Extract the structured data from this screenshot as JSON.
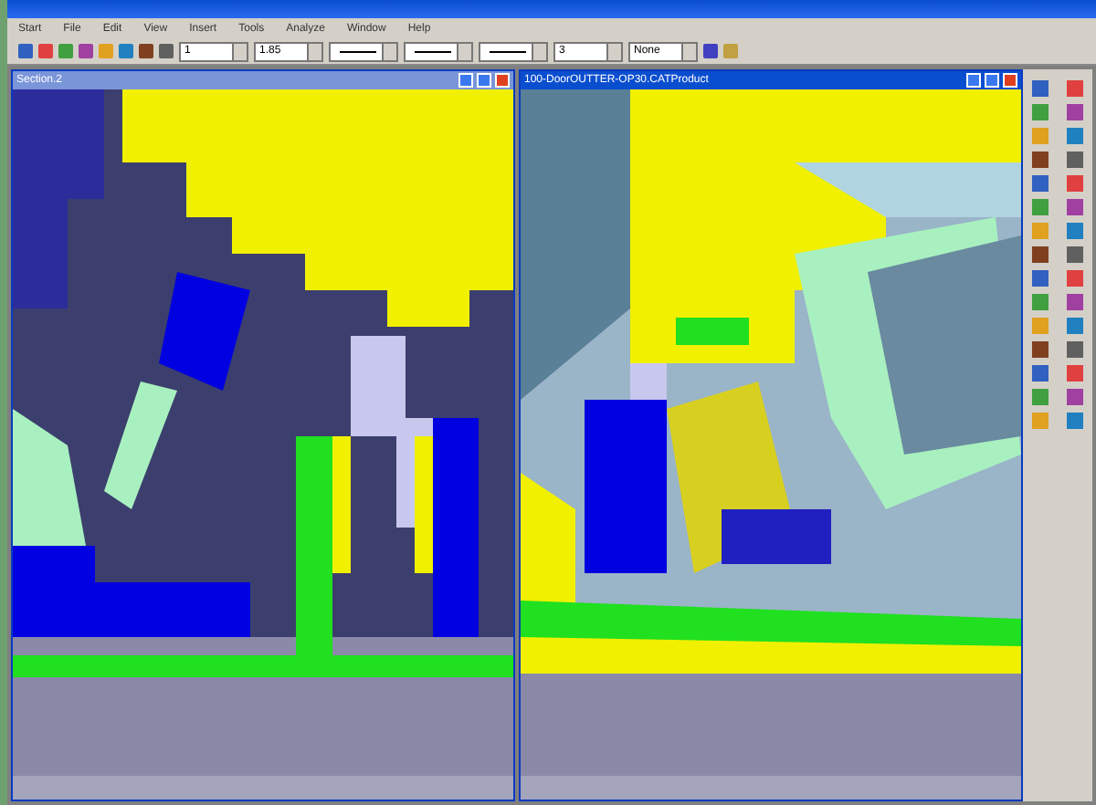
{
  "menu": [
    "Start",
    "File",
    "Edit",
    "View",
    "Insert",
    "Tools",
    "Analyze",
    "Window",
    "Help"
  ],
  "toolbar": {
    "combos": [
      {
        "kind": "text",
        "value": "1"
      },
      {
        "kind": "text",
        "value": "1.85"
      },
      {
        "kind": "line"
      },
      {
        "kind": "line"
      },
      {
        "kind": "line"
      },
      {
        "kind": "text",
        "value": "3"
      },
      {
        "kind": "text",
        "value": "None"
      }
    ]
  },
  "windows": [
    {
      "title": "Section.2",
      "kind": "section",
      "selected": false
    },
    {
      "title": "100-DoorOUTTER-OP30.CATProduct",
      "kind": "solid",
      "selected": true
    }
  ]
}
